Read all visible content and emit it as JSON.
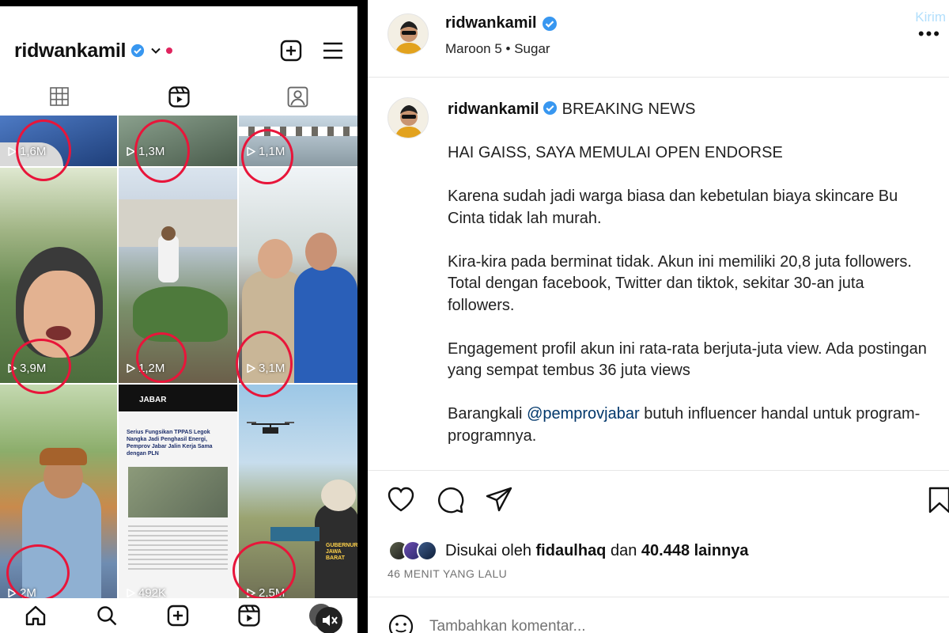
{
  "profile_screen": {
    "username": "ridwankamil",
    "tabs": [
      "grid-icon",
      "reels-icon",
      "tagged-icon"
    ],
    "grid": [
      {
        "views": "1,6M"
      },
      {
        "views": "1,3M"
      },
      {
        "views": "1,1M"
      },
      {
        "views": "3,9M"
      },
      {
        "views": "1,2M"
      },
      {
        "views": "3,1M"
      },
      {
        "views": "2M"
      },
      {
        "views": "492K"
      },
      {
        "views": "2,5M"
      }
    ],
    "news_card": {
      "brand": "JABAR",
      "headline": "Serius Fungsikan TPPAS Legok Nangka Jadi Penghasil Energi, Pemprov Jabar Jalin Kerja Sama dengan PLN"
    },
    "badge_text": "GUBERNUR JAWA BARAT",
    "bottom_nav": [
      "home-icon",
      "search-icon",
      "create-icon",
      "reels-icon",
      "profile-icon"
    ]
  },
  "post": {
    "author": "ridwankamil",
    "music": "Maroon 5 • Sugar",
    "caption_user": "ridwankamil",
    "caption_title": "BREAKING NEWS",
    "paragraphs": [
      "HAI GAISS, SAYA MEMULAI OPEN ENDORSE",
      "Karena sudah jadi warga biasa dan kebetulan biaya skincare Bu Cinta tidak lah murah.",
      "Kira-kira pada berminat tidak. Akun ini memiliki 20,8 juta followers. Total dengan facebook, Twitter dan tiktok, sekitar 30-an juta followers.",
      "Engagement profil akun ini rata-rata berjuta-juta view. Ada postingan yang sempat tembus 36 juta views"
    ],
    "last_prefix": "Barangkali ",
    "mention": "@pemprovjabar",
    "last_suffix": " butuh influencer handal untuk program-programnya.",
    "likes_prefix": "Disukai oleh ",
    "liked_by": "fidaulhaq",
    "likes_mid": " dan ",
    "likes_count": "40.448 lainnya",
    "time": "46 MENIT YANG LALU",
    "comment_placeholder": "Tambahkan komentar...",
    "send_label": "Kirim"
  }
}
